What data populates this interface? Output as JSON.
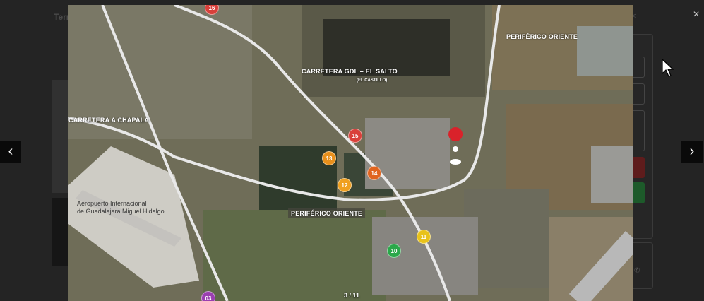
{
  "underlying_page": {
    "title": "Terr",
    "share_label": "r"
  },
  "lightbox": {
    "close_icon": "close-icon",
    "prev_icon": "chevron-left-icon",
    "next_icon": "chevron-right-icon",
    "close_glyph": "×",
    "prev_glyph": "‹",
    "next_glyph": "›",
    "counter": "3 / 11"
  },
  "map": {
    "roads": {
      "carretera_gdl": "CARRETERA GDL – EL SALTO",
      "el_castillo": "(EL CASTILLO)",
      "periferico_oriente_top": "PERIFÉRICO ORIENTE",
      "carretera_chapala": "CARRETERA A CHAPALA",
      "periferico_oriente_bottom": "PERIFÉRICO ORIENTE"
    },
    "airport": {
      "line1": "Aeropuerto Internacional",
      "line2": "de Guadalajara Miguel Hidalgo"
    },
    "markers": [
      {
        "label": "15",
        "color": "#d9403a"
      },
      {
        "label": "14",
        "color": "#e0641f"
      },
      {
        "label": "13",
        "color": "#e8901c"
      },
      {
        "label": "12",
        "color": "#f0a020"
      },
      {
        "label": "11",
        "color": "#e8c21a"
      },
      {
        "label": "10",
        "color": "#2aa84a"
      },
      {
        "label": "16",
        "color": "#d9403a"
      },
      {
        "label": "03",
        "color": "#9a3fb0"
      }
    ],
    "location_pin_color": "#d9222a"
  }
}
